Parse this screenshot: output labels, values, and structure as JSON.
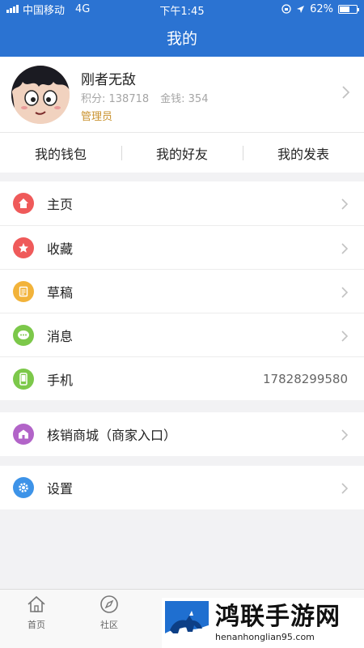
{
  "status_bar": {
    "carrier": "中国移动",
    "network": "4G",
    "time": "下午1:45",
    "battery_percent": "62%",
    "battery_level": 0.62
  },
  "nav": {
    "title": "我的"
  },
  "profile": {
    "username": "刚者无敌",
    "points_label": "积分: 138718",
    "money_label": "金钱: 354",
    "role": "管理员"
  },
  "quick_tabs": [
    {
      "label": "我的钱包"
    },
    {
      "label": "我的好友"
    },
    {
      "label": "我的发表"
    }
  ],
  "menu": {
    "homepage": {
      "label": "主页",
      "color": "#ef5a5a"
    },
    "favorites": {
      "label": "收藏",
      "color": "#ef5a5a"
    },
    "drafts": {
      "label": "草稿",
      "color": "#f2b33a"
    },
    "messages": {
      "label": "消息",
      "color": "#7cc84a"
    },
    "phone": {
      "label": "手机",
      "value": "17828299580",
      "color": "#7cc84a"
    },
    "merchant": {
      "label": "核销商城（商家入口）",
      "color": "#b264c8"
    },
    "settings": {
      "label": "设置",
      "color": "#3d93e8"
    }
  },
  "tab_bar": {
    "home": "首页",
    "community": "社区"
  },
  "watermark": {
    "title": "鸿联手游网",
    "url": "henanhonglian95.com"
  },
  "colors": {
    "primary": "#2b73d2",
    "role": "#c9922e"
  }
}
